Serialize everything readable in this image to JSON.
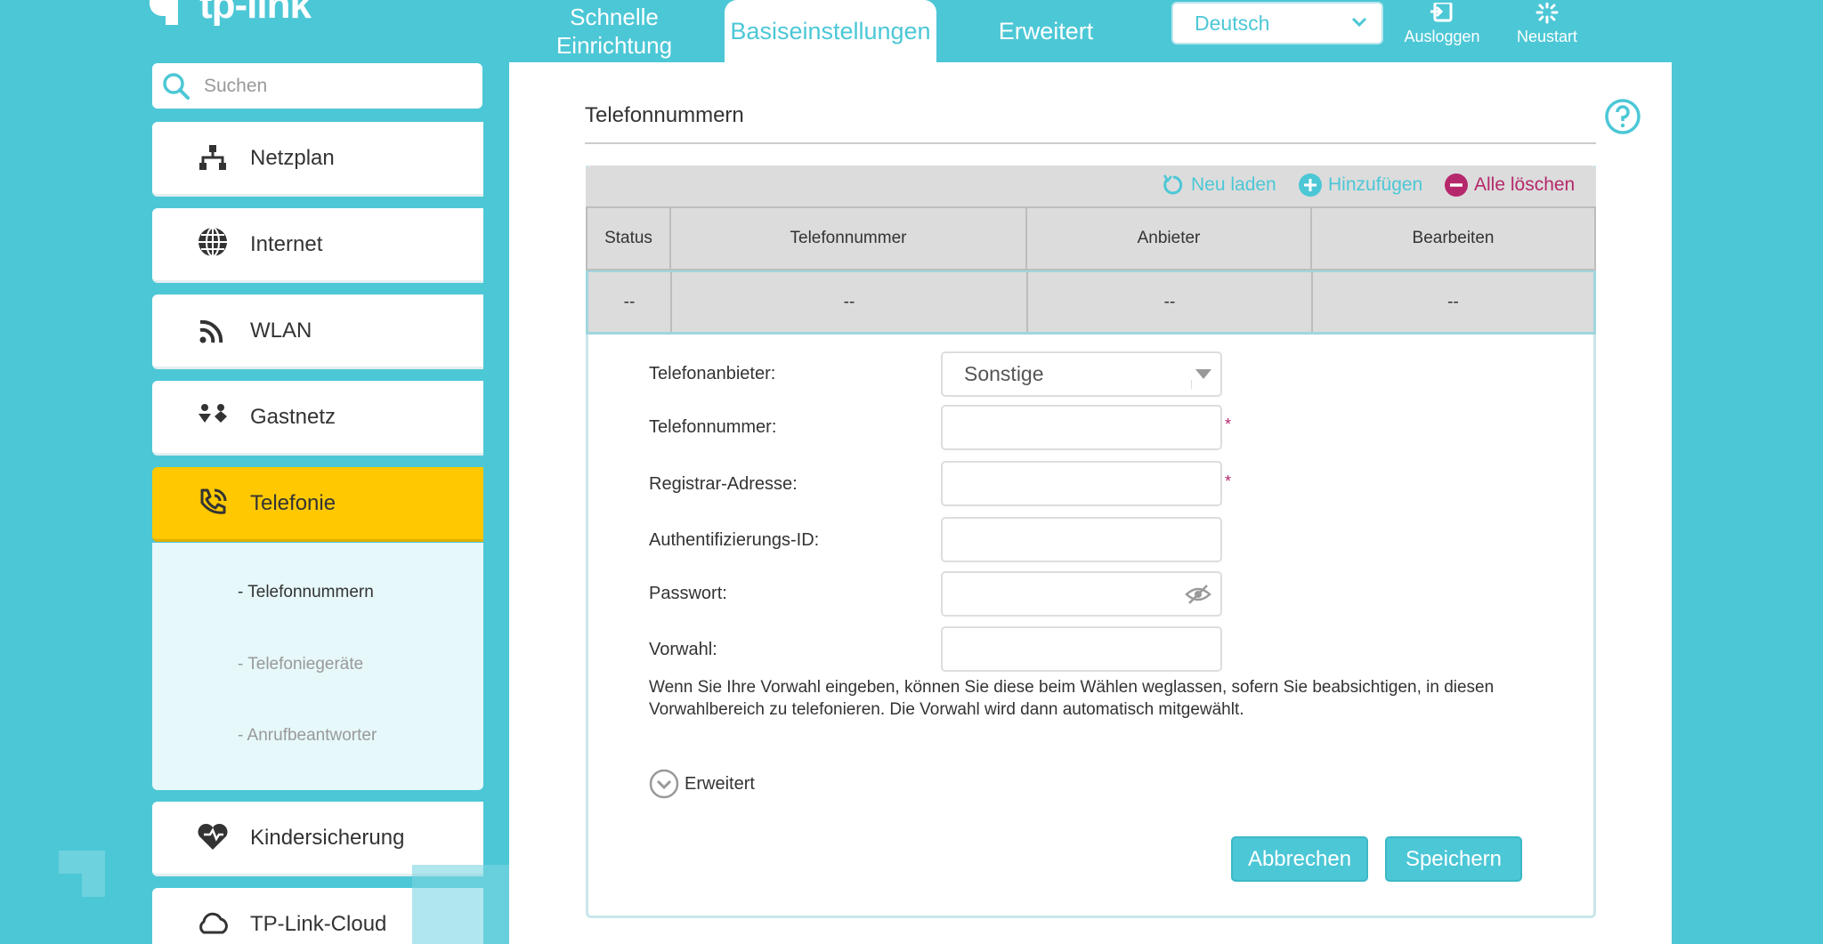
{
  "brand": {
    "logo_text": "tp-link"
  },
  "nav": {
    "tabs": [
      {
        "label_line1": "Schnelle",
        "label_line2": "Einrichtung"
      },
      {
        "label": "Basiseinstellungen"
      },
      {
        "label": "Erweitert"
      }
    ],
    "language": "Deutsch",
    "logout_label": "Ausloggen",
    "reboot_label": "Neustart"
  },
  "sidebar": {
    "search_placeholder": "Suchen",
    "items": [
      {
        "label": "Netzplan",
        "icon": "network-map-icon"
      },
      {
        "label": "Internet",
        "icon": "globe-icon"
      },
      {
        "label": "WLAN",
        "icon": "wifi-icon"
      },
      {
        "label": "Gastnetz",
        "icon": "guest-network-icon"
      },
      {
        "label": "Telefonie",
        "icon": "phone-icon"
      },
      {
        "label": "Kindersicherung",
        "icon": "heart-icon"
      },
      {
        "label": "TP-Link-Cloud",
        "icon": "cloud-icon"
      }
    ],
    "submenu": [
      {
        "label": "- Telefonnummern"
      },
      {
        "label": "- Telefoniegeräte"
      },
      {
        "label": "- Anrufbeantworter"
      }
    ]
  },
  "main": {
    "title": "Telefonnummern",
    "toolbar": {
      "reload": "Neu laden",
      "add": "Hinzufügen",
      "delete_all": "Alle löschen"
    },
    "table": {
      "headers": [
        "Status",
        "Telefonnummer",
        "Anbieter",
        "Bearbeiten"
      ],
      "row": [
        "--",
        "--",
        "--",
        "--"
      ]
    },
    "form": {
      "provider_label": "Telefonanbieter:",
      "provider_value": "Sonstige",
      "phone_label": "Telefonnummer:",
      "registrar_label": "Registrar-Adresse:",
      "auth_label": "Authentifizierungs-ID:",
      "password_label": "Passwort:",
      "area_code_label": "Vorwahl:",
      "required_mark": "*",
      "hint": "Wenn Sie Ihre Vorwahl eingeben, können Sie diese beim Wählen weglassen, sofern Sie beabsichtigen, in diesen Vorwahlbereich zu telefonieren. Die Vorwahl wird dann automatisch mitgewählt.",
      "advanced_label": "Erweitert"
    },
    "buttons": {
      "cancel": "Abbrechen",
      "save": "Speichern"
    }
  },
  "colors": {
    "accent": "#4cc7d6",
    "active": "#ffc800",
    "danger": "#b5286b"
  }
}
